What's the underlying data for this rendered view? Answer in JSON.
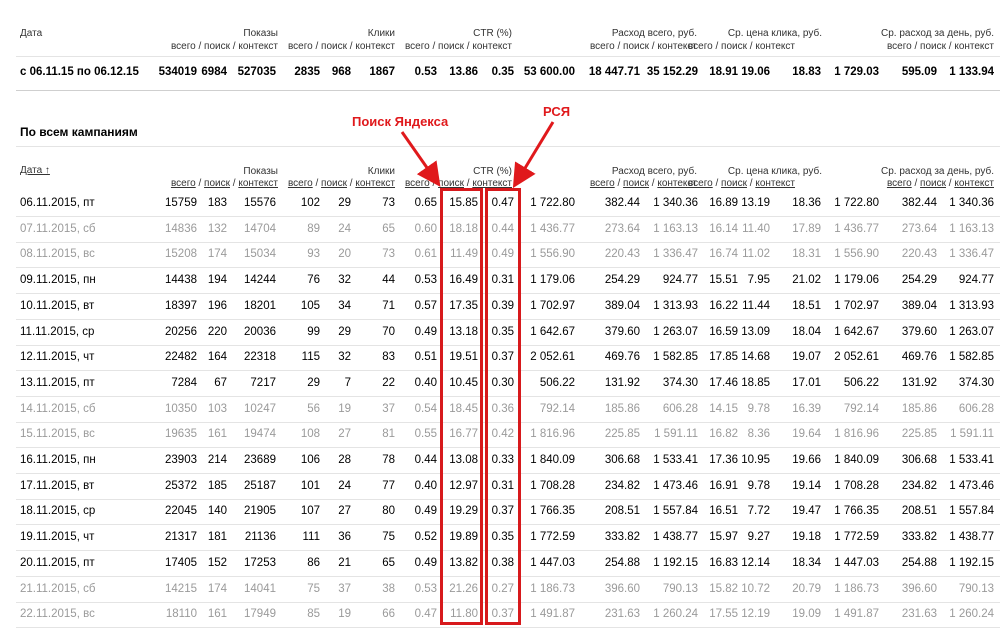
{
  "summary": {
    "headers": {
      "date": "Дата",
      "shows": "Показы",
      "clicks": "Клики",
      "ctr": "CTR (%)",
      "spend": "Расход всего, руб.",
      "avg_cpc": "Ср. цена клика, руб.",
      "avg_daily": "Ср. расход за день, руб."
    },
    "sub": {
      "total": "всего",
      "search": "поиск",
      "context": "контекст",
      "sep": "/"
    },
    "row": [
      "с 06.11.15 по 06.12.15",
      "534019",
      "6984",
      "527035",
      "2835",
      "968",
      "1867",
      "0.53",
      "13.86",
      "0.35",
      "53 600.00",
      "18 447.71",
      "35 152.29",
      "18.91",
      "19.06",
      "18.83",
      "1 729.03",
      "595.09",
      "1 133.94"
    ]
  },
  "section_title": "По всем кампаниям",
  "table": {
    "date_header": "Дата ↑",
    "rows": [
      [
        "06.11.2015, пт",
        "15759",
        "183",
        "15576",
        "102",
        "29",
        "73",
        "0.65",
        "15.85",
        "0.47",
        "1 722.80",
        "382.44",
        "1 340.36",
        "16.89",
        "13.19",
        "18.36",
        "1 722.80",
        "382.44",
        "1 340.36"
      ],
      [
        "07.11.2015, сб",
        "14836",
        "132",
        "14704",
        "89",
        "24",
        "65",
        "0.60",
        "18.18",
        "0.44",
        "1 436.77",
        "273.64",
        "1 163.13",
        "16.14",
        "11.40",
        "17.89",
        "1 436.77",
        "273.64",
        "1 163.13"
      ],
      [
        "08.11.2015, вс",
        "15208",
        "174",
        "15034",
        "93",
        "20",
        "73",
        "0.61",
        "11.49",
        "0.49",
        "1 556.90",
        "220.43",
        "1 336.47",
        "16.74",
        "11.02",
        "18.31",
        "1 556.90",
        "220.43",
        "1 336.47"
      ],
      [
        "09.11.2015, пн",
        "14438",
        "194",
        "14244",
        "76",
        "32",
        "44",
        "0.53",
        "16.49",
        "0.31",
        "1 179.06",
        "254.29",
        "924.77",
        "15.51",
        "7.95",
        "21.02",
        "1 179.06",
        "254.29",
        "924.77"
      ],
      [
        "10.11.2015, вт",
        "18397",
        "196",
        "18201",
        "105",
        "34",
        "71",
        "0.57",
        "17.35",
        "0.39",
        "1 702.97",
        "389.04",
        "1 313.93",
        "16.22",
        "11.44",
        "18.51",
        "1 702.97",
        "389.04",
        "1 313.93"
      ],
      [
        "11.11.2015, ср",
        "20256",
        "220",
        "20036",
        "99",
        "29",
        "70",
        "0.49",
        "13.18",
        "0.35",
        "1 642.67",
        "379.60",
        "1 263.07",
        "16.59",
        "13.09",
        "18.04",
        "1 642.67",
        "379.60",
        "1 263.07"
      ],
      [
        "12.11.2015, чт",
        "22482",
        "164",
        "22318",
        "115",
        "32",
        "83",
        "0.51",
        "19.51",
        "0.37",
        "2 052.61",
        "469.76",
        "1 582.85",
        "17.85",
        "14.68",
        "19.07",
        "2 052.61",
        "469.76",
        "1 582.85"
      ],
      [
        "13.11.2015, пт",
        "7284",
        "67",
        "7217",
        "29",
        "7",
        "22",
        "0.40",
        "10.45",
        "0.30",
        "506.22",
        "131.92",
        "374.30",
        "17.46",
        "18.85",
        "17.01",
        "506.22",
        "131.92",
        "374.30"
      ],
      [
        "14.11.2015, сб",
        "10350",
        "103",
        "10247",
        "56",
        "19",
        "37",
        "0.54",
        "18.45",
        "0.36",
        "792.14",
        "185.86",
        "606.28",
        "14.15",
        "9.78",
        "16.39",
        "792.14",
        "185.86",
        "606.28"
      ],
      [
        "15.11.2015, вс",
        "19635",
        "161",
        "19474",
        "108",
        "27",
        "81",
        "0.55",
        "16.77",
        "0.42",
        "1 816.96",
        "225.85",
        "1 591.11",
        "16.82",
        "8.36",
        "19.64",
        "1 816.96",
        "225.85",
        "1 591.11"
      ],
      [
        "16.11.2015, пн",
        "23903",
        "214",
        "23689",
        "106",
        "28",
        "78",
        "0.44",
        "13.08",
        "0.33",
        "1 840.09",
        "306.68",
        "1 533.41",
        "17.36",
        "10.95",
        "19.66",
        "1 840.09",
        "306.68",
        "1 533.41"
      ],
      [
        "17.11.2015, вт",
        "25372",
        "185",
        "25187",
        "101",
        "24",
        "77",
        "0.40",
        "12.97",
        "0.31",
        "1 708.28",
        "234.82",
        "1 473.46",
        "16.91",
        "9.78",
        "19.14",
        "1 708.28",
        "234.82",
        "1 473.46"
      ],
      [
        "18.11.2015, ср",
        "22045",
        "140",
        "21905",
        "107",
        "27",
        "80",
        "0.49",
        "19.29",
        "0.37",
        "1 766.35",
        "208.51",
        "1 557.84",
        "16.51",
        "7.72",
        "19.47",
        "1 766.35",
        "208.51",
        "1 557.84"
      ],
      [
        "19.11.2015, чт",
        "21317",
        "181",
        "21136",
        "111",
        "36",
        "75",
        "0.52",
        "19.89",
        "0.35",
        "1 772.59",
        "333.82",
        "1 438.77",
        "15.97",
        "9.27",
        "19.18",
        "1 772.59",
        "333.82",
        "1 438.77"
      ],
      [
        "20.11.2015, пт",
        "17405",
        "152",
        "17253",
        "86",
        "21",
        "65",
        "0.49",
        "13.82",
        "0.38",
        "1 447.03",
        "254.88",
        "1 192.15",
        "16.83",
        "12.14",
        "18.34",
        "1 447.03",
        "254.88",
        "1 192.15"
      ],
      [
        "21.11.2015, сб",
        "14215",
        "174",
        "14041",
        "75",
        "37",
        "38",
        "0.53",
        "21.26",
        "0.27",
        "1 186.73",
        "396.60",
        "790.13",
        "15.82",
        "10.72",
        "20.79",
        "1 186.73",
        "396.60",
        "790.13"
      ],
      [
        "22.11.2015, вс",
        "18110",
        "161",
        "17949",
        "85",
        "19",
        "66",
        "0.47",
        "11.80",
        "0.37",
        "1 491.87",
        "231.63",
        "1 260.24",
        "17.55",
        "12.19",
        "19.09",
        "1 491.87",
        "231.63",
        "1 260.24"
      ]
    ],
    "weekend_rows": [
      1,
      2,
      8,
      9,
      15,
      16
    ]
  },
  "annotations": {
    "search": "Поиск Яндекса",
    "rsya": "РСЯ",
    "color": "#d7191c"
  }
}
